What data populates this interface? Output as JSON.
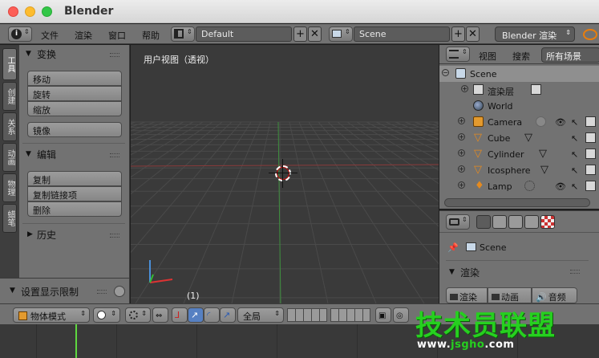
{
  "window": {
    "title": "Blender"
  },
  "info_header": {
    "menus": [
      "文件",
      "渲染",
      "窗口",
      "帮助"
    ],
    "screen_layout": "Default",
    "scene": "Scene",
    "render_engine": "Blender 渲染"
  },
  "tool_tabs": [
    "工具",
    "创建",
    "关系",
    "动画",
    "物理",
    "蜡笔"
  ],
  "tool_shelf": {
    "transform_title": "变换",
    "transform_buttons": [
      "移动",
      "旋转",
      "缩放"
    ],
    "mirror_button": "镜像",
    "edit_title": "编辑",
    "edit_buttons": [
      "复制",
      "复制链接项",
      "删除"
    ],
    "history_title": "历史",
    "display_limits": "设置显示限制"
  },
  "viewport": {
    "view_name": "用户视图（透视）",
    "frame_label": "(1)"
  },
  "outliner_header": {
    "view_menu": "视图",
    "search_menu": "搜索",
    "filter": "所有场景"
  },
  "outliner": {
    "scene": "Scene",
    "render_layers": "渲染层",
    "world": "World",
    "objects": [
      "Camera",
      "Cube",
      "Cylinder",
      "Icosphere",
      "Lamp"
    ]
  },
  "properties": {
    "scene_name": "Scene",
    "render_panel": "渲染",
    "buttons": [
      "渲染",
      "动画",
      "音频"
    ]
  },
  "viewport_header": {
    "mode": "物体模式",
    "orientation": "全局"
  },
  "watermark": {
    "line1": "技术员联盟",
    "line2_prefix": "www.",
    "line2_domain": "jsgho",
    "line2_suffix": ".com"
  },
  "colors": {
    "editor_bg": "#727272",
    "viewport_bg": "#3a3a3a",
    "selection": "#ffaa40",
    "x_axis": "#b53a3a",
    "y_axis": "#3a9a3a",
    "watermark": "#26d01f"
  }
}
